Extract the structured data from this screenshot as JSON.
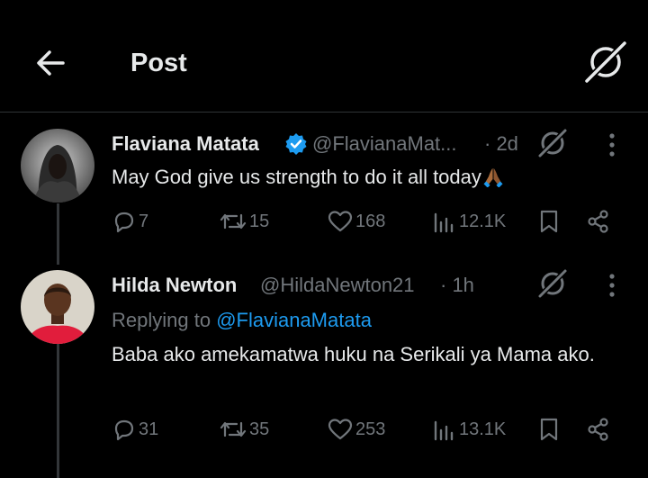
{
  "header": {
    "title": "Post"
  },
  "icons": {
    "back": "arrow-left-icon",
    "grok": "grok-icon",
    "more": "more-vertical-icon",
    "reply": "reply-icon",
    "repost": "repost-icon",
    "like": "heart-icon",
    "views": "views-icon",
    "bookmark": "bookmark-icon",
    "share": "share-icon",
    "verified": "verified-badge-icon"
  },
  "colors": {
    "background": "#000000",
    "text": "#e7e9ea",
    "muted": "#71767b",
    "accent": "#1d9bf0",
    "divider": "#2f3336"
  },
  "posts": [
    {
      "name": "Flaviana Matata",
      "handle": "@FlavianaMat...",
      "time": "· 2d",
      "verified": true,
      "text": "May God give us strength to do it all today",
      "emoji": "folded-hands-emoji",
      "stats": {
        "replies": "7",
        "reposts": "15",
        "likes": "168",
        "views": "12.1K"
      }
    },
    {
      "name": "Hilda Newton",
      "handle": "@HildaNewton21",
      "time": "· 1h",
      "verified": false,
      "replying_label": "Replying to ",
      "replying_to": "@FlavianaMatata",
      "text": "Baba ako amekamatwa huku na Serikali ya Mama ako.",
      "stats": {
        "replies": "31",
        "reposts": "35",
        "likes": "253",
        "views": "13.1K"
      }
    }
  ]
}
